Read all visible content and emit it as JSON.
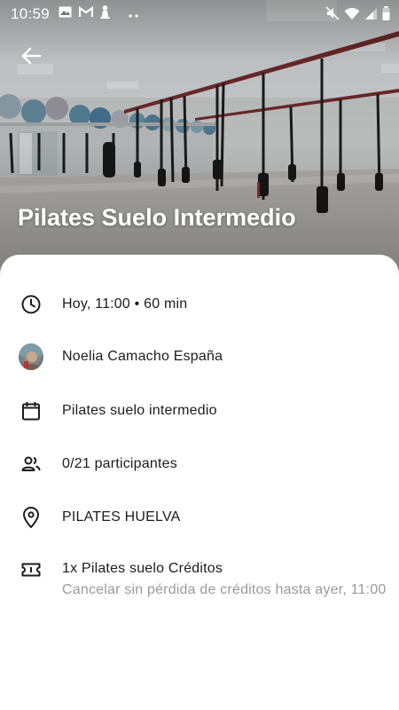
{
  "status_bar": {
    "time": "10:59",
    "left_icons": [
      "image-icon",
      "gmail-icon",
      "pawn-icon",
      "more-dots-icon"
    ],
    "right_icons": [
      "mute-icon",
      "wifi-icon",
      "signal-icon",
      "battery-icon"
    ]
  },
  "header": {
    "back_icon": "arrow-left-icon",
    "title": "Pilates Suelo Intermedio"
  },
  "details": {
    "time": {
      "icon": "clock-icon",
      "text": "Hoy, 11:00 • 60 min"
    },
    "instructor": {
      "icon": "avatar",
      "text": "Noelia Camacho España"
    },
    "class_type": {
      "icon": "calendar-icon",
      "text": "Pilates suelo intermedio"
    },
    "participants": {
      "icon": "people-icon",
      "text": "0/21 participantes"
    },
    "location": {
      "icon": "location-pin-icon",
      "text": "PILATES HUELVA"
    },
    "credits": {
      "icon": "ticket-icon",
      "text": "1x Pilates suelo Créditos",
      "note": "Cancelar sin pérdida de créditos hasta ayer, 11:00"
    }
  },
  "colors": {
    "primary_text": "#1c1c1e",
    "secondary_text": "#9a9a9a",
    "card_background": "#ffffff",
    "title_text": "#ffffff"
  }
}
